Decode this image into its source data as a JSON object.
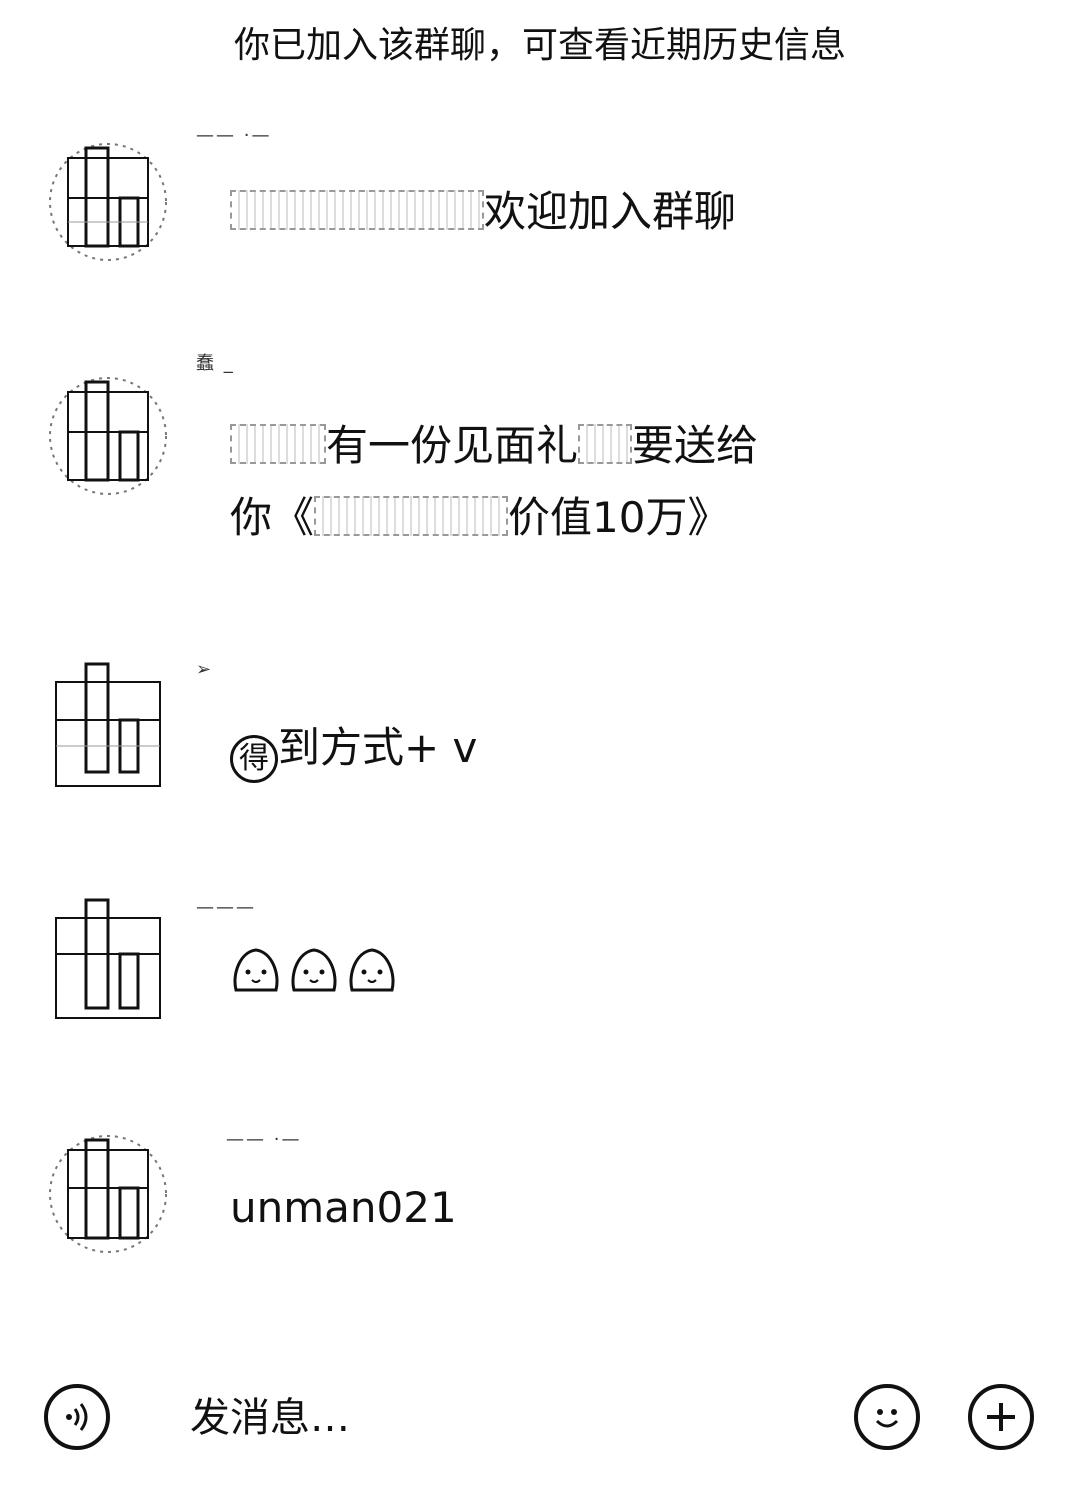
{
  "system_notice": "你已加入该群聊，可查看近期历史信息",
  "messages": [
    {
      "sender": "—— ·—",
      "text_suffix": "欢迎加入群聊"
    },
    {
      "sender": "蠢 _",
      "line1_suffix": "有一份见面礼",
      "line1_end": "要送给",
      "line2_prefix": "你《",
      "line2_suffix": "价值10万》"
    },
    {
      "sender": "➢",
      "badge": "得",
      "text": "到方式+ v"
    },
    {
      "sender": "———",
      "emoji_count": 3
    },
    {
      "sender": "—— ·—",
      "text": "unman021"
    }
  ],
  "footer": {
    "voice_icon": "voice-icon",
    "input_placeholder": "发消息…",
    "emoji_icon": "smiley-icon",
    "plus_icon": "plus-icon"
  }
}
